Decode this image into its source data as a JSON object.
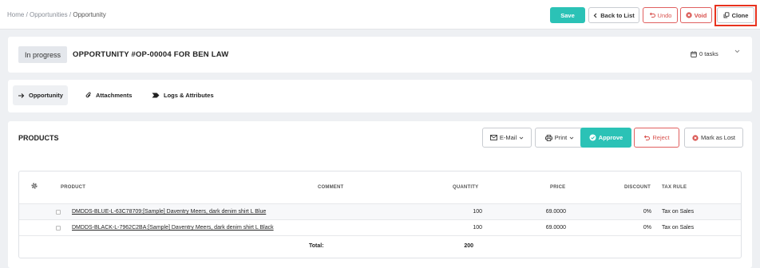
{
  "breadcrumb": {
    "home": "Home",
    "opportunities": "Opportunities",
    "current": "Opportunity",
    "separator": "/"
  },
  "toolbar": {
    "save": "Save",
    "back": "Back to List",
    "undo": "Undo",
    "void": "Void",
    "clone": "Clone"
  },
  "header": {
    "status": "In progress",
    "title": "OPPORTUNITY #OP-00004 FOR BEN LAW",
    "tasks": "0 tasks"
  },
  "tabs": [
    {
      "label": "Opportunity",
      "icon": "arrow-right-icon"
    },
    {
      "label": "Attachments",
      "icon": "paperclip-icon"
    },
    {
      "label": "Logs & Attributes",
      "icon": "tag-icon"
    }
  ],
  "products": {
    "title": "PRODUCTS",
    "buttons": {
      "email": "E-Mail",
      "print": "Print",
      "approve": "Approve",
      "reject": "Reject",
      "mark_lost": "Mark as Lost"
    },
    "columns": {
      "product": "PRODUCT",
      "comment": "COMMENT",
      "quantity": "QUANTITY",
      "price": "PRICE",
      "discount": "DISCOUNT",
      "tax_rule": "TAX RULE"
    },
    "rows": [
      {
        "product": "DMDDS-BLUE-L-63C78709:[Sample] Daventry Meers, dark denim shirt L Blue",
        "comment": "",
        "quantity": "100",
        "price": "69.0000",
        "discount": "0%",
        "tax_rule": "Tax on Sales"
      },
      {
        "product": "DMDDS-BLACK-L-7962C2BA:[Sample] Daventry Meers, dark denim shirt L Black",
        "comment": "",
        "quantity": "100",
        "price": "69.0000",
        "discount": "0%",
        "tax_rule": "Tax on Sales"
      }
    ],
    "total_label": "Total:",
    "total_quantity": "200"
  },
  "colors": {
    "accent": "#2bc2b6",
    "danger": "#d9534f",
    "highlight": "#e8321e"
  }
}
